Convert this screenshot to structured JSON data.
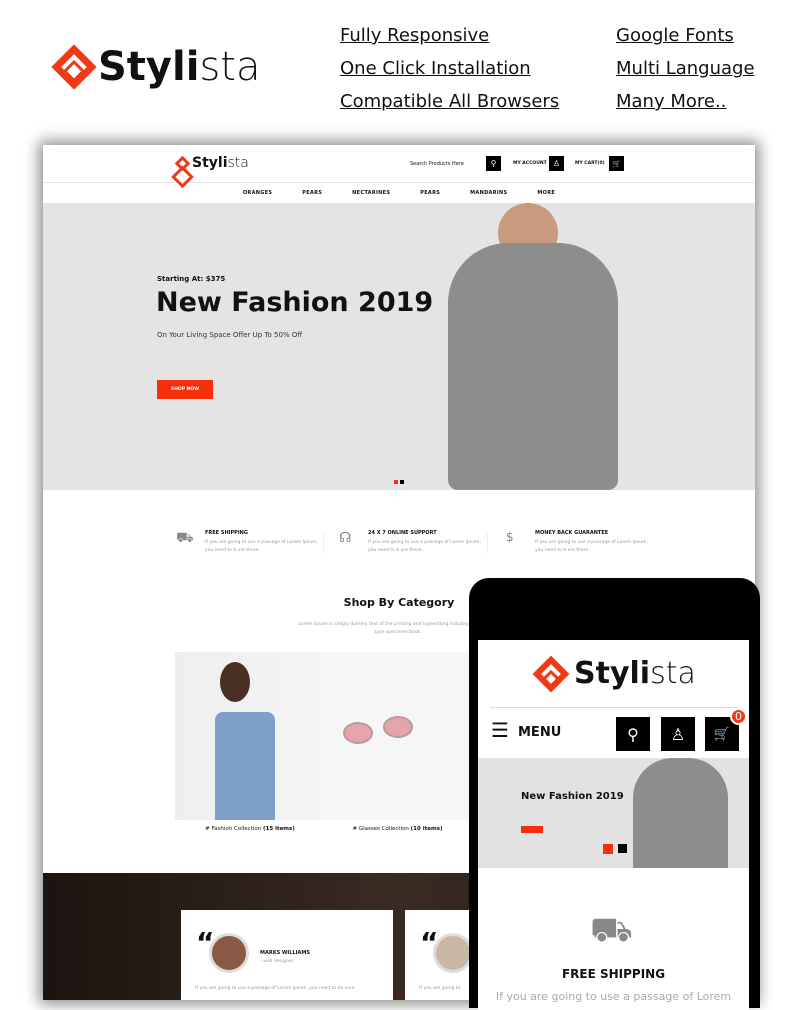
{
  "brand": {
    "logo_bold": "Styli",
    "logo_light": "sta",
    "accent": "#f03a17"
  },
  "features_left": [
    "Fully Responsive",
    "One Click Installation",
    "Compatible All Browsers"
  ],
  "features_right": [
    "Google Fonts",
    "Multi Language",
    "Many More.."
  ],
  "desktop": {
    "search_placeholder": "Search Products Here",
    "account": "MY ACCOUNT",
    "cart": "MY CART(0)",
    "nav": [
      "ORANGES",
      "PEARS",
      "NECTARINES",
      "PEARS",
      "MANDARINS",
      "MORE"
    ],
    "hero": {
      "starting": "Starting At:  $375",
      "title": "New Fashion 2019",
      "subtitle": "On Your Living Space Offer Up To 50% Off",
      "button": "SHOP NOW"
    },
    "services": [
      {
        "icon": "truck-icon",
        "title": "FREE SHIPPING",
        "text": "If you are going to use a passage of Lorem Ipsum, you need to b ure there.."
      },
      {
        "icon": "headset-icon",
        "title": "24 X 7 ONLINE SUPPORT",
        "text": "If you are going to use a passage of Lorem Ipsum, you need to b ure there.."
      },
      {
        "icon": "money-hand-icon",
        "title": "MONEY BACK GUARANTEE",
        "text": "If you are going to use a passage of Lorem Ipsum, you need to b ure there.."
      }
    ],
    "category": {
      "title": "Shop By Category",
      "subtitle": "Lorem Ipsum is simply dummy text of the printing and typesetting industry. it to make a type specimen book.",
      "items": [
        {
          "prefix": "# Fashion Collection",
          "count": "(15 items)"
        },
        {
          "prefix": "# Glasses Collection",
          "count": "(10 items)"
        }
      ]
    },
    "testimonial": {
      "name": "MARKS WILLIAMS",
      "role": "- web designer",
      "text": "If you are going to use a passage of Lorem Ipsum, you need to be sure",
      "text2": "If you are going to"
    }
  },
  "mobile": {
    "menu": "MENU",
    "cart_count": "0",
    "hero_title": "New Fashion 2019",
    "service_title": "FREE SHIPPING",
    "service_text": "If you are going to use a passage of Lorem"
  }
}
